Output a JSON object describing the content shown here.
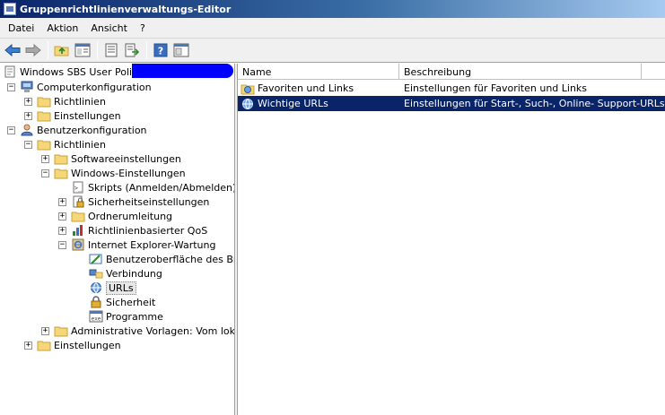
{
  "window": {
    "title": "Gruppenrichtlinienverwaltungs-Editor"
  },
  "menu": [
    "Datei",
    "Aktion",
    "Ansicht",
    "?"
  ],
  "toolbar": {
    "buttons": [
      "back-arrow-icon",
      "forward-arrow-icon",
      "up-folder-icon",
      "show-hide-tree-icon",
      "properties-icon",
      "export-list-icon",
      "help-icon",
      "mmc-window-icon"
    ]
  },
  "tree": {
    "root": "Windows SBS User Policy",
    "computer": "Computerkonfiguration",
    "c_richtlinien": "Richtlinien",
    "c_einstellungen": "Einstellungen",
    "user": "Benutzerkonfiguration",
    "u_richtlinien": "Richtlinien",
    "softwareeinstellungen": "Softwareeinstellungen",
    "windows_einstellungen": "Windows-Einstellungen",
    "skripts": "Skripts (Anmelden/Abmelden)",
    "sicherheitseinstellungen": "Sicherheitseinstellungen",
    "ordnerumleitung": "Ordnerumleitung",
    "qos": "Richtlinienbasierter QoS",
    "ie_wartung": "Internet Explorer-Wartung",
    "benutzeroberflaeche": "Benutzeroberfläche des Brov",
    "verbindung": "Verbindung",
    "urls": "URLs",
    "sicherheit": "Sicherheit",
    "programme": "Programme",
    "admin_vorlagen": "Administrative Vorlagen: Vom lokalen",
    "u_einstellungen": "Einstellungen"
  },
  "list": {
    "columns": [
      "Name",
      "Beschreibung"
    ],
    "rows": [
      {
        "name": "Favoriten und Links",
        "description": "Einstellungen für Favoriten und Links"
      },
      {
        "name": "Wichtige URLs",
        "description": "Einstellungen für Start-, Such-, Online- Support-URLs"
      }
    ]
  },
  "colors": {
    "selection": "#0a246a",
    "redaction": "#0000ff",
    "folder": "#f5d77a"
  }
}
